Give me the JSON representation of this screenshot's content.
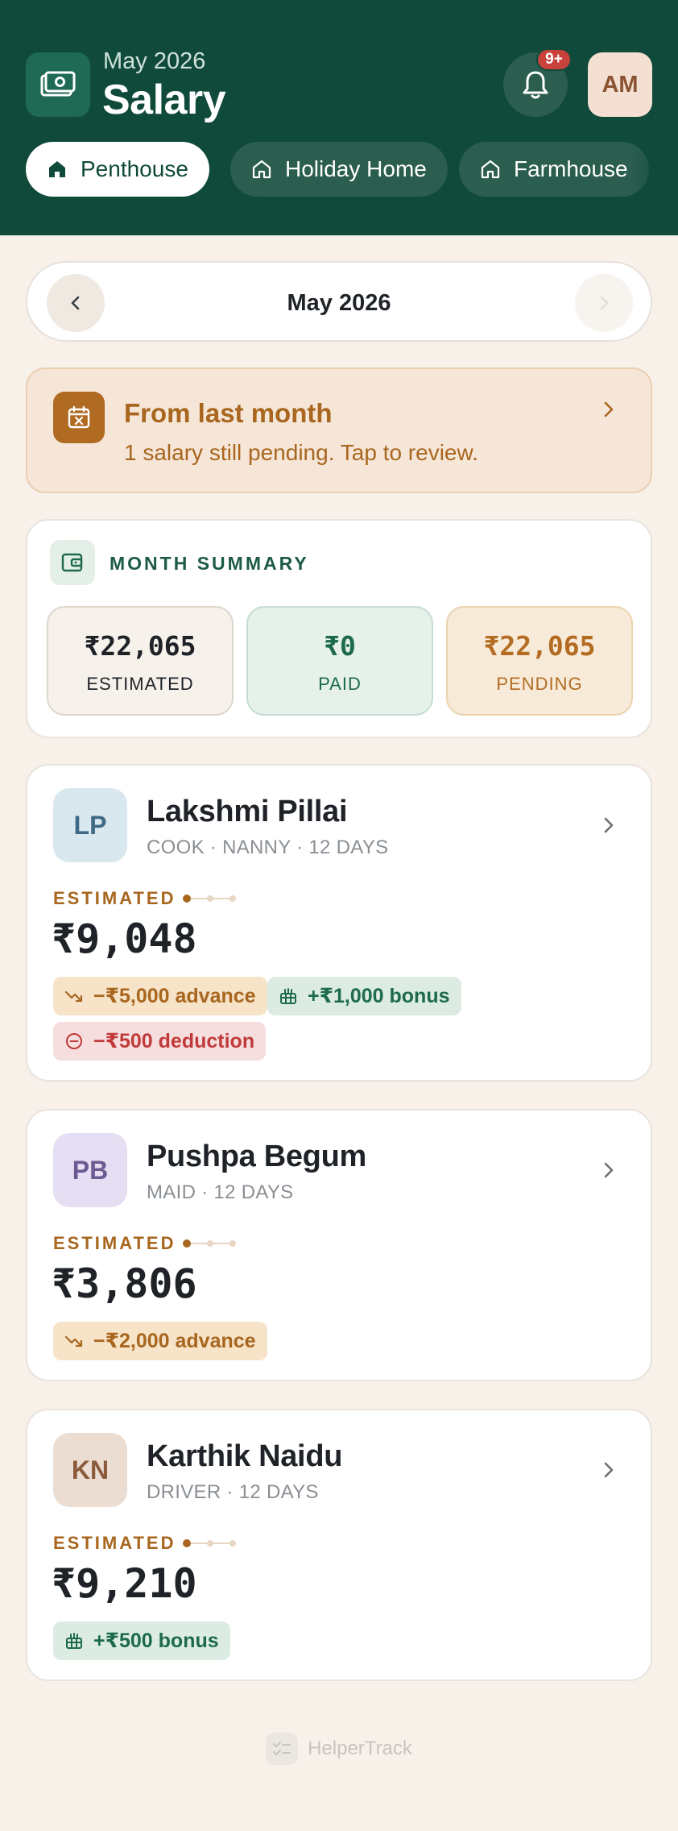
{
  "header": {
    "subtitle": "May 2026",
    "title": "Salary",
    "notification_badge": "9+",
    "user_initials": "AM"
  },
  "tabs": [
    {
      "label": "Penthouse",
      "active": true
    },
    {
      "label": "Holiday Home",
      "active": false
    },
    {
      "label": "Farmhouse",
      "active": false
    }
  ],
  "month_selector": {
    "label": "May 2026"
  },
  "alert": {
    "title": "From last month",
    "text": "1 salary still pending. Tap to review."
  },
  "summary": {
    "title": "MONTH SUMMARY",
    "estimated": {
      "amount": "₹22,065",
      "label": "ESTIMATED"
    },
    "paid": {
      "amount": "₹0",
      "label": "PAID"
    },
    "pending": {
      "amount": "₹22,065",
      "label": "PENDING"
    }
  },
  "workers": [
    {
      "initials": "LP",
      "name": "Lakshmi Pillai",
      "role": "COOK · NANNY · 12 DAYS",
      "estimated_label": "ESTIMATED",
      "amount": "₹9,048",
      "chips": [
        {
          "type": "advance",
          "text": "−₹5,000 advance"
        },
        {
          "type": "bonus",
          "text": "+₹1,000 bonus"
        },
        {
          "type": "deduction",
          "text": "−₹500 deduction"
        }
      ]
    },
    {
      "initials": "PB",
      "name": "Pushpa Begum",
      "role": "MAID · 12 DAYS",
      "estimated_label": "ESTIMATED",
      "amount": "₹3,806",
      "chips": [
        {
          "type": "advance",
          "text": "−₹2,000 advance"
        }
      ]
    },
    {
      "initials": "KN",
      "name": "Karthik Naidu",
      "role": "DRIVER · 12 DAYS",
      "estimated_label": "ESTIMATED",
      "amount": "₹9,210",
      "chips": [
        {
          "type": "bonus",
          "text": "+₹500 bonus"
        }
      ]
    }
  ],
  "footer": {
    "brand": "HelperTrack"
  },
  "colors": {
    "header_bg": "#0f4a3a",
    "accent_green": "#1d6a4e",
    "accent_amber": "#a8661e",
    "danger": "#c03a3a",
    "page_bg": "#f7f1ea"
  }
}
